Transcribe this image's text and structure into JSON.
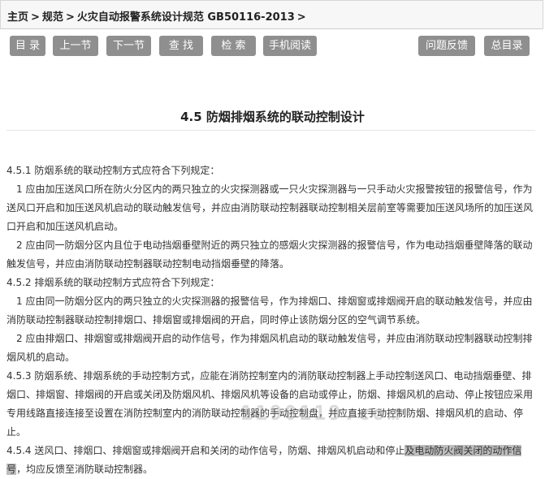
{
  "breadcrumb": {
    "home": "主页",
    "standards": "规范",
    "document": "火灾自动报警系统设计规范 GB50116-2013",
    "separator": ">"
  },
  "toolbar": {
    "catalog": "目 录",
    "prev": "上一节",
    "next": "下一节",
    "find": "查 找",
    "search": "检 索",
    "mobile": "手机阅读",
    "feedback": "问题反馈",
    "master_catalog": "总目录"
  },
  "section_title": "4.5 防烟排烟系统的联动控制设计",
  "paragraphs": {
    "p1": "4.5.1 防烟系统的联动控制方式应符合下列规定：",
    "p2": "1 应由加压送风口所在防火分区内的两只独立的火灾探测器或一只火灾探测器与一只手动火灾报警按钮的报警信号，作为送风口开启和加压送风机启动的联动触发信号，并应由消防联动控制器联动控制相关层前室等需要加压送风场所的加压送风口开启和加压送风机启动。",
    "p3": "2 应由同一防烟分区内且位于电动挡烟垂壁附近的两只独立的感烟火灾探测器的报警信号，作为电动挡烟垂壁降落的联动触发信号，并应由消防联动控制器联动控制电动挡烟垂壁的降落。",
    "p4": "4.5.2 排烟系统的联动控制方式应符合下列规定：",
    "p5": "1 应由同一防烟分区内的两只独立的火灾探测器的报警信号，作为排烟口、排烟窗或排烟阀开启的联动触发信号，并应由消防联动控制器联动控制排烟口、排烟窗或排烟阀的开启，同时停止该防烟分区的空气调节系统。",
    "p6": "2 应由排烟口、排烟窗或排烟阀开启的动作信号，作为排烟风机启动的联动触发信号，并应由消防联动控制器联动控制排烟风机的启动。",
    "p7": "4.5.3 防烟系统、排烟系统的手动控制方式，应能在消防控制室内的消防联动控制器上手动控制送风口、电动挡烟垂壁、排烟口、排烟窗、排烟阀的开启或关闭及防烟风机、排烟风机等设备的启动或停止，防烟、排烟风机的启动、停止按钮应采用专用线路直接连接至设置在消防控制室内的消防联动控制器的手动控制盘，并应直接手动控制防烟、排烟风机的启动、停止。",
    "p8_a": "4.5.4 送风口、排烟口、排烟窗或排烟阀开启和关闭的动作信号，防烟、排烟风机启动和停止",
    "p8_highlight": "及电动防火阀关闭的动作信号",
    "p8_b": "，均应反馈至消防联动控制器。"
  },
  "watermark": "1190119.com"
}
